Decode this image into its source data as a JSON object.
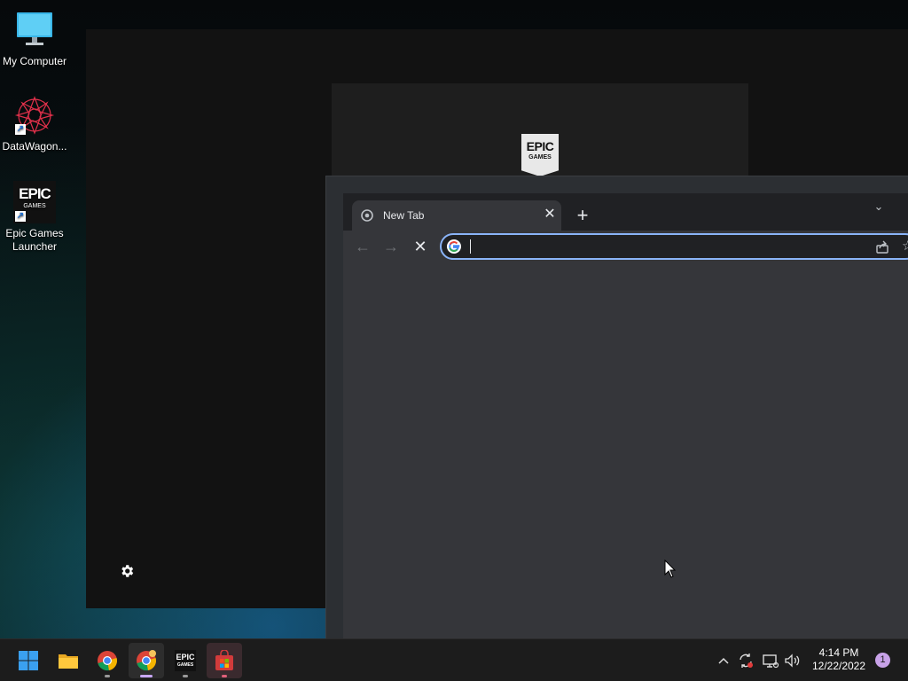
{
  "desktop": {
    "icons": [
      {
        "label": "My Computer",
        "icon": "monitor-icon"
      },
      {
        "label": "DataWagon...",
        "icon": "datawagon-icon"
      },
      {
        "label": "Epic Games Launcher",
        "icon": "epic-games-icon"
      }
    ]
  },
  "epic_launcher": {
    "logo_line1": "EPIC",
    "logo_line2": "GAMES",
    "settings_icon": "gear-icon"
  },
  "browser": {
    "tab": {
      "title": "New Tab",
      "close_glyph": "✕"
    },
    "new_tab_glyph": "+",
    "tab_search_glyph": "⌄",
    "nav": {
      "back_glyph": "←",
      "forward_glyph": "→",
      "stop_glyph": "✕"
    },
    "omnibox": {
      "value": "",
      "placeholder": ""
    },
    "star_glyph": "☆"
  },
  "taskbar": {
    "apps": [
      {
        "name": "start",
        "icon": "windows-start-icon"
      },
      {
        "name": "file-explorer",
        "icon": "folder-icon"
      },
      {
        "name": "chrome",
        "icon": "chrome-icon"
      },
      {
        "name": "chrome-profile",
        "icon": "chrome-profile-icon"
      },
      {
        "name": "epic-games",
        "icon": "epic-games-icon",
        "label1": "EPIC",
        "label2": "GAMES"
      },
      {
        "name": "microsoft-store",
        "icon": "store-icon"
      }
    ],
    "tray": {
      "chevron_glyph": "^",
      "time": "4:14 PM",
      "date": "12/22/2022",
      "notification_count": "1"
    }
  },
  "colors": {
    "accent": "#8ab4f8",
    "taskbar_bg": "#1c1c1c",
    "chrome_bg": "#35363a",
    "tabstrip_bg": "#202124"
  }
}
